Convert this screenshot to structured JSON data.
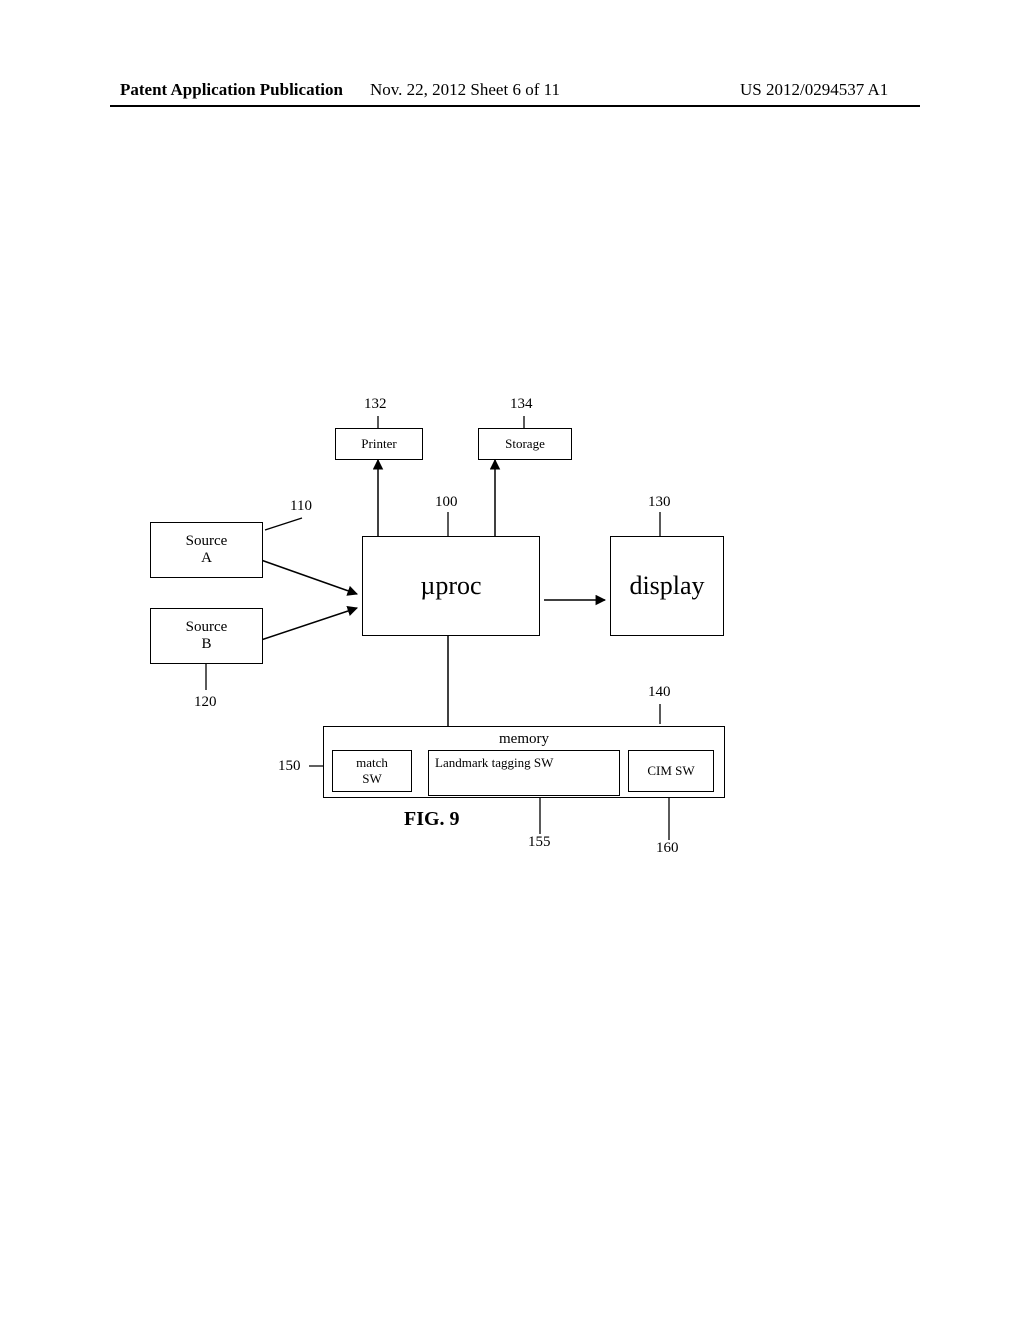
{
  "header": {
    "left": "Patent Application Publication",
    "center": "Nov. 22, 2012  Sheet 6 of 11",
    "right": "US 2012/0294537 A1"
  },
  "figure_label": "FIG. 9",
  "boxes": {
    "printer": "Printer",
    "storage": "Storage",
    "source_a": "Source\nA",
    "source_b": "Source\nB",
    "uproc": "µproc",
    "display": "display",
    "memory_title": "memory",
    "match_sw": "match\nSW",
    "landmark_sw": "Landmark tagging SW",
    "cim_sw": "CIM SW"
  },
  "refs": {
    "r132": "132",
    "r134": "134",
    "r100": "100",
    "r110": "110",
    "r130": "130",
    "r120": "120",
    "r140": "140",
    "r150": "150",
    "r155": "155",
    "r160": "160"
  }
}
